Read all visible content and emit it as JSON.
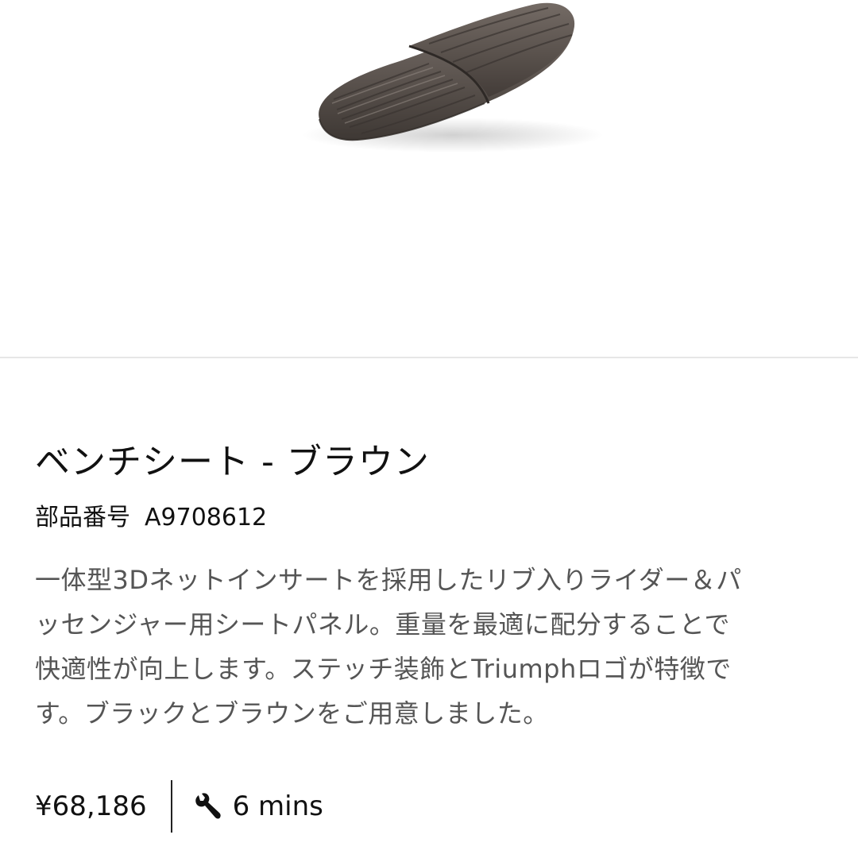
{
  "product": {
    "image_alt": "bench-seat-brown-product-photo",
    "title": "ベンチシート - ブラウン",
    "part_number_label": "部品番号",
    "part_number": "A9708612",
    "description_lines": [
      "一体型3Dネットインサートを採用したリブ入りライダー＆パ",
      "ッセンジャー用シートパネル。重量を最適に配分することで",
      "快適性が向上します。ステッチ装飾とTriumphロゴが特徴で",
      "す。ブラックとブラウンをご用意しました。"
    ],
    "price": "¥68,186",
    "fit_time": "6 mins",
    "fit_time_icon": "wrench-icon"
  },
  "colors": {
    "seat_base": "#5a524d",
    "seat_highlight": "#8a817b",
    "divider": "#e6e6e6",
    "description_text": "#555555"
  }
}
